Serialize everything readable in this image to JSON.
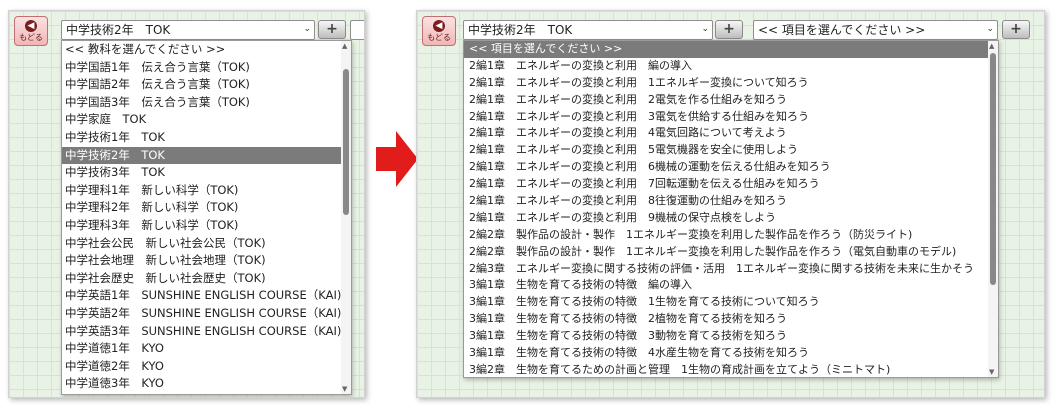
{
  "back_label": "もどる",
  "plus_label": "+",
  "left": {
    "subject_value": "中学技術2年　TOK",
    "dropdown_items": [
      "<< 教科を選んでください >>",
      "中学国語1年　伝え合う言葉（TOK)",
      "中学国語2年　伝え合う言葉（TOK)",
      "中学国語3年　伝え合う言葉（TOK)",
      "中学家庭　TOK",
      "中学技術1年　TOK",
      "中学技術2年　TOK",
      "中学技術3年　TOK",
      "中学理科1年　新しい科学（TOK)",
      "中学理科2年　新しい科学（TOK)",
      "中学理科3年　新しい科学（TOK)",
      "中学社会公民　新しい社会公民（TOK)",
      "中学社会地理　新しい社会地理（TOK)",
      "中学社会歴史　新しい社会歴史（TOK)",
      "中学英語1年　SUNSHINE ENGLISH COURSE（KAI)",
      "中学英語2年　SUNSHINE ENGLISH COURSE（KAI)",
      "中学英語3年　SUNSHINE ENGLISH COURSE（KAI)",
      "中学道徳1年　KYO",
      "中学道徳2年　KYO",
      "中学道徳3年　KYO"
    ],
    "selected_index": 6
  },
  "right": {
    "subject_value": "中学技術2年　TOK",
    "item_value": "<< 項目を選んでください >>",
    "dropdown_items": [
      "<< 項目を選んでください >>",
      "2編1章　エネルギーの変換と利用　編の導入",
      "2編1章　エネルギーの変換と利用　1エネルギー変換について知ろう",
      "2編1章　エネルギーの変換と利用　2電気を作る仕組みを知ろう",
      "2編1章　エネルギーの変換と利用　3電気を供給する仕組みを知ろう",
      "2編1章　エネルギーの変換と利用　4電気回路について考えよう",
      "2編1章　エネルギーの変換と利用　5電気機器を安全に使用しよう",
      "2編1章　エネルギーの変換と利用　6機械の運動を伝える仕組みを知ろう",
      "2編1章　エネルギーの変換と利用　7回転運動を伝える仕組みを知ろう",
      "2編1章　エネルギーの変換と利用　8往復運動の仕組みを知ろう",
      "2編1章　エネルギーの変換と利用　9機械の保守点検をしよう",
      "2編2章　製作品の設計・製作　1エネルギー変換を利用した製作品を作ろう（防災ライト)",
      "2編2章　製作品の設計・製作　1エネルギー変換を利用した製作品を作ろう（電気自動車のモデル)",
      "2編3章　エネルギー変換に関する技術の評価・活用　1エネルギー変換に関する技術を未来に生かそう",
      "3編1章　生物を育てる技術の特徴　編の導入",
      "3編1章　生物を育てる技術の特徴　1生物を育てる技術について知ろう",
      "3編1章　生物を育てる技術の特徴　2植物を育てる技術を知ろう",
      "3編1章　生物を育てる技術の特徴　3動物を育てる技術を知ろう",
      "3編1章　生物を育てる技術の特徴　4水産生物を育てる技術を知ろう",
      "3編2章　生物を育てるための計画と管理　1生物の育成計画を立てよう（ミニトマト)"
    ],
    "selected_index": 0
  },
  "colors": {
    "selected_bg": "#7b7b7b",
    "arrow": "#e21b1b",
    "back_button": "#f2b6b6",
    "grid_bg": "#e9f3e5"
  }
}
